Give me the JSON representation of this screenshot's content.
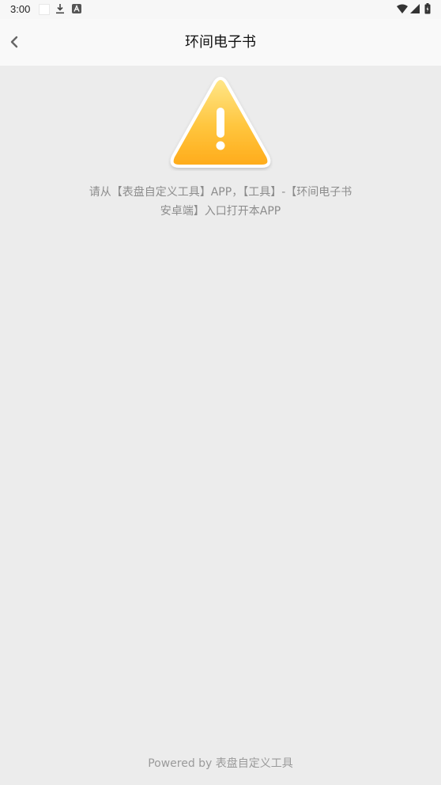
{
  "status_bar": {
    "time": "3:00",
    "icons": [
      "blank-notification-icon",
      "download-icon",
      "app-notification-icon",
      "wifi-icon",
      "signal-icon",
      "battery-icon"
    ]
  },
  "app_bar": {
    "back_icon": "chevron-left-icon",
    "title": "环间电子书"
  },
  "warning": {
    "icon": "warning-triangle-icon",
    "message_line1": "请从【表盘自定义工具】APP，【工具】-【环间电子书",
    "message_line2": "安卓端】入口打开本APP"
  },
  "footer": {
    "text": "Powered by 表盘自定义工具"
  },
  "colors": {
    "background": "#ececec",
    "warning_fill_top": "#ffd666",
    "warning_fill_bottom": "#ffad1f",
    "text_secondary": "#8c8c8c"
  }
}
